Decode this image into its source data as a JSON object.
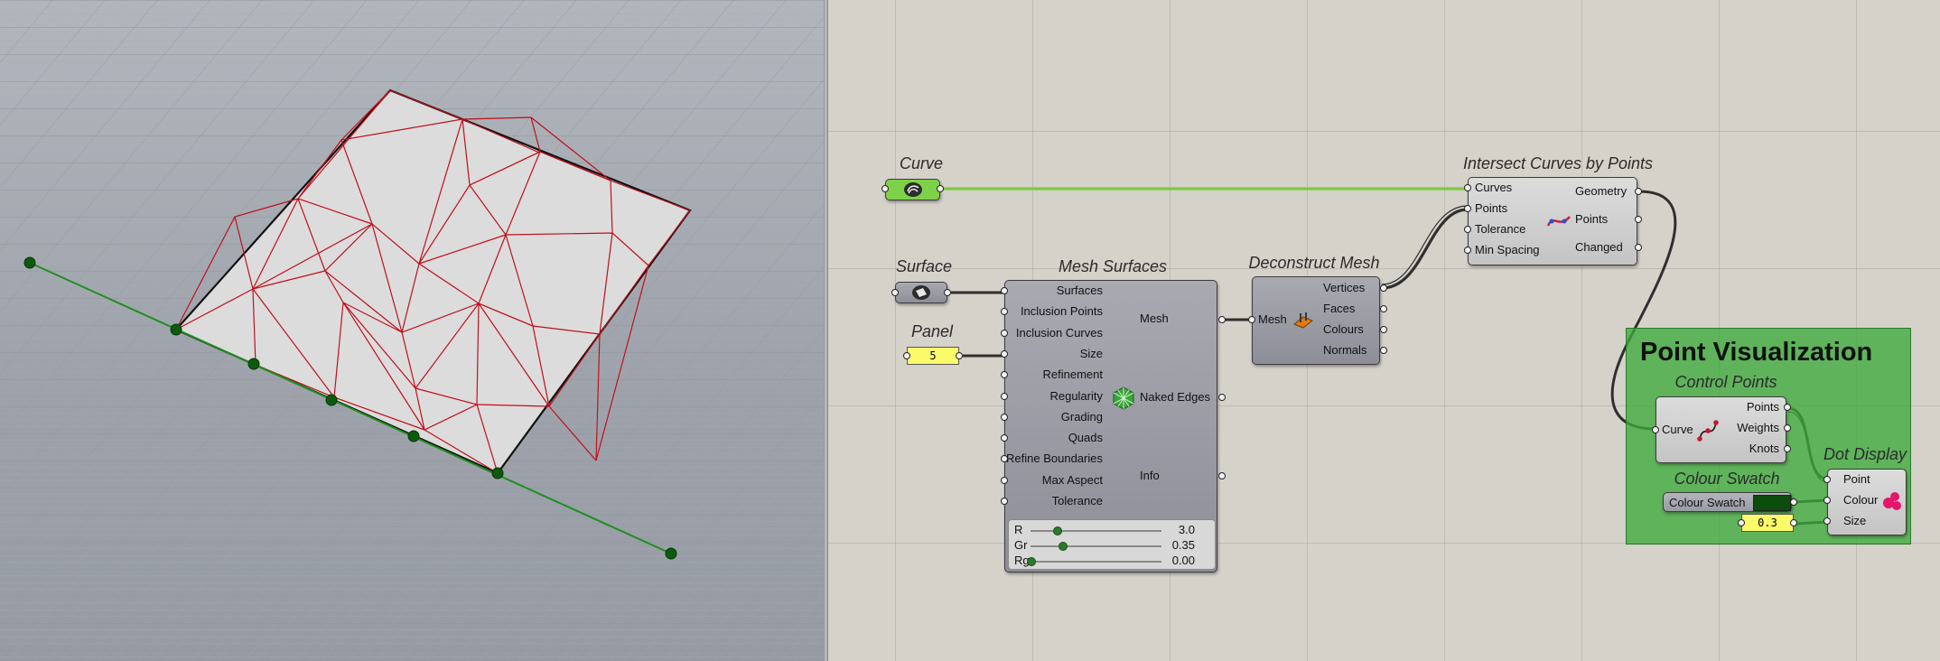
{
  "viewport": {
    "surface_fill": "#dcdcdc",
    "mesh_edge_color": "#c0101a",
    "curve_color": "#1f8f1f",
    "point_color": "#0d5a0d"
  },
  "canvas": {
    "wire_color": "#2f2f2f",
    "selected_wire_color": "#7ac943"
  },
  "curve_param": {
    "nickname": "Curve",
    "icon": "curve-param-icon",
    "color": "#7ed24a"
  },
  "surface_param": {
    "nickname": "Surface",
    "icon": "surface-param-icon"
  },
  "panel": {
    "nickname": "Panel",
    "value": "5"
  },
  "mesh_surfaces": {
    "nickname": "Mesh Surfaces",
    "icon": "mesh-surface-icon",
    "inputs": [
      "Surfaces",
      "Inclusion Points",
      "Inclusion Curves",
      "Size",
      "Refinement",
      "Regularity",
      "Grading",
      "Quads",
      "Refine Boundaries",
      "Max Aspect",
      "Tolerance"
    ],
    "outputs": {
      "mesh": "Mesh",
      "naked_edges": "Naked Edges",
      "info": "Info"
    },
    "sliders": [
      {
        "label": "R",
        "value": "3.0"
      },
      {
        "label": "Gr",
        "value": "0.35"
      },
      {
        "label": "Rg",
        "value": "0.00"
      }
    ]
  },
  "deconstruct_mesh": {
    "nickname": "Deconstruct Mesh",
    "icon": "deconstruct-mesh-icon",
    "input": "Mesh",
    "outputs": [
      "Vertices",
      "Faces",
      "Colours",
      "Normals"
    ]
  },
  "intersect": {
    "nickname": "Intersect Curves by Points",
    "icon": "curve-points-icon",
    "inputs": [
      "Curves",
      "Points",
      "Tolerance",
      "Min Spacing"
    ],
    "outputs": [
      "Geometry",
      "Points",
      "Changed"
    ]
  },
  "group": {
    "title": "Point Visualization",
    "color": "#3caa3c",
    "control_points": {
      "nickname": "Control Points",
      "icon": "control-points-icon",
      "input": "Curve",
      "outputs": [
        "Points",
        "Weights",
        "Knots"
      ]
    },
    "colour_swatch": {
      "nickname": "Colour Swatch",
      "label": "Colour Swatch",
      "color": "#0b4d0b"
    },
    "size_panel": {
      "value": "0.3"
    },
    "dot_display": {
      "nickname": "Dot Display",
      "icon": "dot-display-icon",
      "inputs": [
        "Point",
        "Colour",
        "Size"
      ]
    }
  }
}
